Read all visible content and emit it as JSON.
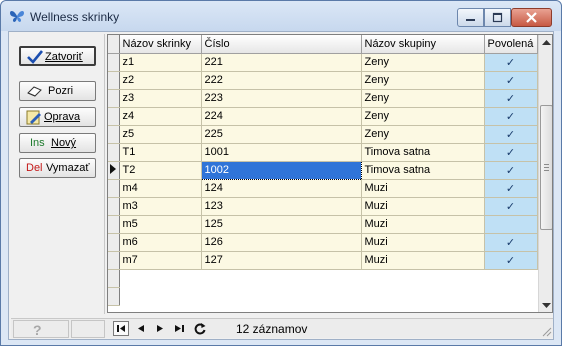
{
  "window": {
    "title": "Wellness skrinky",
    "icon": "butterfly-icon"
  },
  "buttons": {
    "close": {
      "label": "Zatvoriť",
      "icon": "checkmark-icon"
    },
    "view": {
      "label": "Pozri",
      "icon": "eraser-icon"
    },
    "edit": {
      "label": "Oprava",
      "icon": "pencil-icon"
    },
    "new": {
      "prefix": "Ins",
      "label": "Nový"
    },
    "delete": {
      "prefix": "Del",
      "label": "Vymazať"
    }
  },
  "grid": {
    "columns": [
      "Názov skrinky",
      "Číslo",
      "Názov skupiny",
      "Povolená"
    ],
    "current_row": 6,
    "rows": [
      {
        "name": "z1",
        "number": "221",
        "group": "Zeny",
        "allowed": true
      },
      {
        "name": "z2",
        "number": "222",
        "group": "Zeny",
        "allowed": true
      },
      {
        "name": "z3",
        "number": "223",
        "group": "Zeny",
        "allowed": true
      },
      {
        "name": "z4",
        "number": "224",
        "group": "Zeny",
        "allowed": true
      },
      {
        "name": "z5",
        "number": "225",
        "group": "Zeny",
        "allowed": true
      },
      {
        "name": "T1",
        "number": "1001",
        "group": "Timova satna",
        "allowed": true
      },
      {
        "name": "T2",
        "number": "1002",
        "group": "Timova satna",
        "allowed": true
      },
      {
        "name": "m4",
        "number": "124",
        "group": "Muzi",
        "allowed": true
      },
      {
        "name": "m3",
        "number": "123",
        "group": "Muzi",
        "allowed": true
      },
      {
        "name": "m5",
        "number": "125",
        "group": "Muzi",
        "allowed": false
      },
      {
        "name": "m6",
        "number": "126",
        "group": "Muzi",
        "allowed": true
      },
      {
        "name": "m7",
        "number": "127",
        "group": "Muzi",
        "allowed": true
      }
    ],
    "check_glyph": "✓"
  },
  "status": {
    "record_count": "12 záznamov"
  }
}
